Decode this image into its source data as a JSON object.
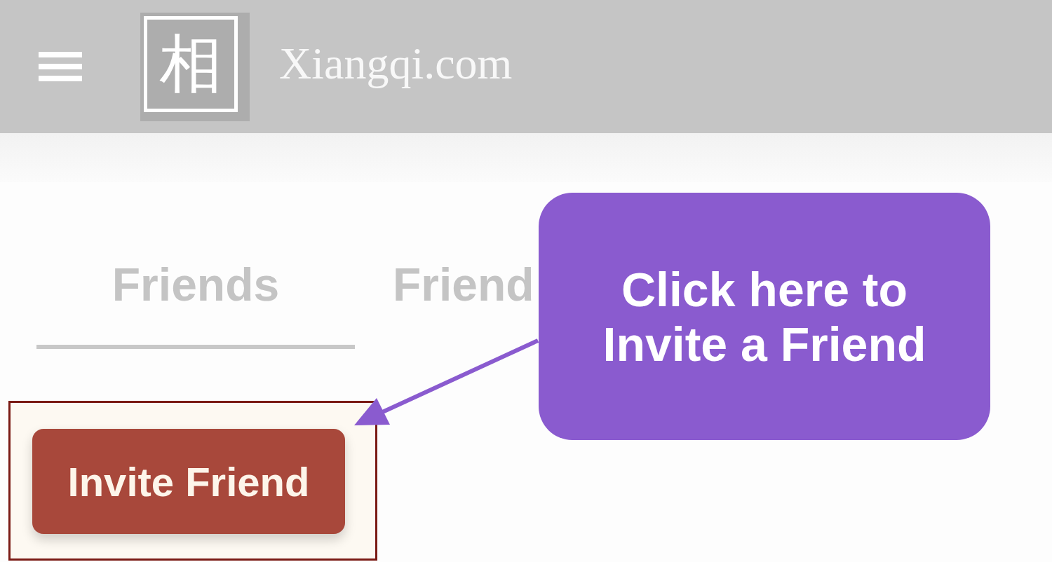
{
  "header": {
    "logo_glyph": "相",
    "brand": "Xiangqi.com"
  },
  "tabs": [
    {
      "label": "Friends",
      "selected": true
    },
    {
      "label": "Friend",
      "selected": false
    }
  ],
  "invite_button": {
    "label": "Invite Friend",
    "highlighted": true
  },
  "callout": {
    "text": "Click here to Invite a Friend"
  }
}
